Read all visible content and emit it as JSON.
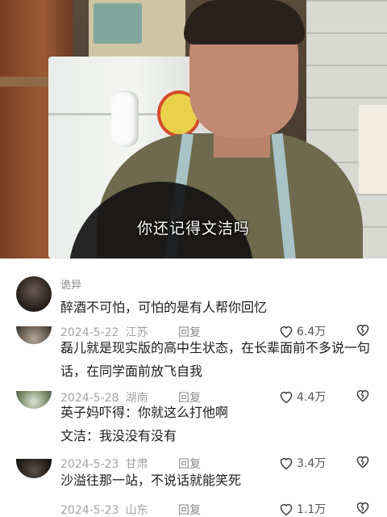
{
  "video": {
    "subtitle": "你还记得文洁吗"
  },
  "comments": [
    {
      "username": "诡异",
      "text": "醉酒不可怕，可怕的是有人帮你回忆",
      "date": "2024-5-22",
      "location": "江苏",
      "reply_label": "回复",
      "likes": "6.4万"
    },
    {
      "username": "",
      "text": "磊儿就是现实版的高中生状态，在长辈面前不多说一句话，在同学面前放飞自我",
      "date": "2024-5-28",
      "location": "湖南",
      "reply_label": "回复",
      "likes": "4.4万"
    },
    {
      "username": "",
      "text": "英子妈吓得：你就这么打他啊\n文洁：我没没有没有",
      "date": "2024-5-23",
      "location": "甘肃",
      "reply_label": "回复",
      "likes": "3.4万"
    },
    {
      "username": "",
      "text": "沙溢往那一站，不说话就能笑死",
      "date": "2024-5-23",
      "location": "山东",
      "reply_label": "回复",
      "likes": "1.1万"
    }
  ],
  "icons": {
    "like": "heart-outline-icon",
    "dislike": "broken-heart-icon"
  },
  "colors": {
    "meta_text": "#a3a3a3",
    "body_text": "#1d1d1d"
  }
}
